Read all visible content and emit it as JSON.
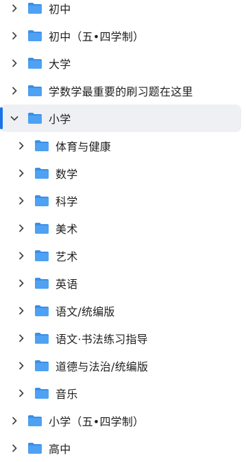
{
  "tree": {
    "items": [
      {
        "label": "初中",
        "level": 0,
        "expanded": false,
        "selected": false
      },
      {
        "label": "初中（五•四学制）",
        "level": 0,
        "expanded": false,
        "selected": false
      },
      {
        "label": "大学",
        "level": 0,
        "expanded": false,
        "selected": false
      },
      {
        "label": "学数学最重要的刷习题在这里",
        "level": 0,
        "expanded": false,
        "selected": false
      },
      {
        "label": "小学",
        "level": 0,
        "expanded": true,
        "selected": true
      },
      {
        "label": "体育与健康",
        "level": 1,
        "expanded": false,
        "selected": false
      },
      {
        "label": "数学",
        "level": 1,
        "expanded": false,
        "selected": false
      },
      {
        "label": "科学",
        "level": 1,
        "expanded": false,
        "selected": false
      },
      {
        "label": "美术",
        "level": 1,
        "expanded": false,
        "selected": false
      },
      {
        "label": "艺术",
        "level": 1,
        "expanded": false,
        "selected": false
      },
      {
        "label": "英语",
        "level": 1,
        "expanded": false,
        "selected": false
      },
      {
        "label": "语文/统编版",
        "level": 1,
        "expanded": false,
        "selected": false
      },
      {
        "label": "语文·书法练习指导",
        "level": 1,
        "expanded": false,
        "selected": false
      },
      {
        "label": "道德与法治/统编版",
        "level": 1,
        "expanded": false,
        "selected": false
      },
      {
        "label": "音乐",
        "level": 1,
        "expanded": false,
        "selected": false
      },
      {
        "label": "小学（五•四学制）",
        "level": 0,
        "expanded": false,
        "selected": false
      },
      {
        "label": "高中",
        "level": 0,
        "expanded": false,
        "selected": false
      }
    ]
  },
  "colors": {
    "folder": "#4ea1f3",
    "folder_tab": "#3a8fe6",
    "selected_bg": "#eef0f3",
    "indicator": "#1a73e8",
    "chevron": "#444444",
    "text": "#1f1f1f"
  },
  "icons": {
    "chevron_collapsed": "chevron-right-icon",
    "chevron_expanded": "chevron-down-icon",
    "folder": "folder-icon"
  }
}
